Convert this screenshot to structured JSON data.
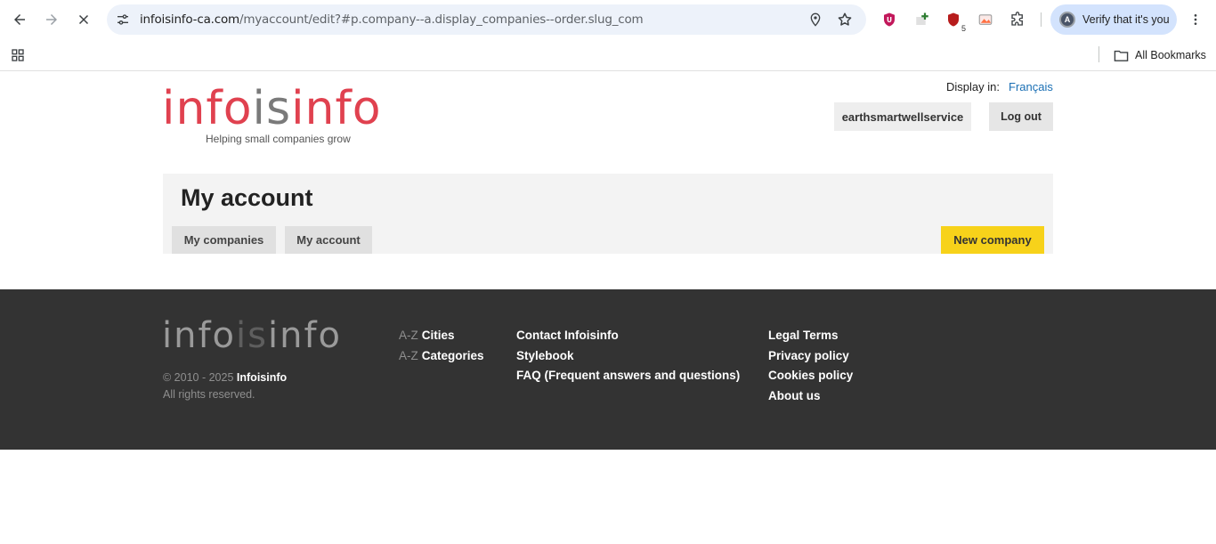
{
  "browser": {
    "url_host": "infoisinfo-ca.com",
    "url_path": "/myaccount/edit?#p.company--a.display_companies--order.slug_com",
    "verify_label": "Verify that it's you",
    "avatar_letter": "A",
    "extension_badge": "5",
    "all_bookmarks": "All Bookmarks"
  },
  "header": {
    "logo_part1": "info",
    "logo_part2": "is",
    "logo_part3": "info",
    "tagline": "Helping small companies grow",
    "display_in_label": "Display in:",
    "language_link": "Français",
    "username": "earthsmartwellservice",
    "logout_label": "Log out"
  },
  "account": {
    "title": "My account",
    "tabs": [
      {
        "label": "My companies"
      },
      {
        "label": "My account"
      }
    ],
    "new_company_label": "New company"
  },
  "footer": {
    "logo_part1": "info",
    "logo_part2": "is",
    "logo_part3": "info",
    "copyright_prefix": "© 2010 - 2025",
    "copyright_brand": "Infoisinfo",
    "rights": "All rights reserved.",
    "az_prefix": "A-Z",
    "az_links": [
      {
        "label": "Cities"
      },
      {
        "label": "Categories"
      }
    ],
    "info_links": [
      {
        "label": "Contact Infoisinfo"
      },
      {
        "label": "Stylebook"
      },
      {
        "label": "FAQ (Frequent answers and questions)"
      }
    ],
    "legal_links": [
      {
        "label": "Legal Terms"
      },
      {
        "label": "Privacy policy"
      },
      {
        "label": "Cookies policy"
      },
      {
        "label": "About us"
      }
    ]
  },
  "colors": {
    "logo_red": "#e0414f",
    "logo_grey": "#7a7a7a",
    "new_company_yellow": "#f7d21a",
    "footer_bg": "#333333",
    "link_blue": "#1a6fb4"
  }
}
